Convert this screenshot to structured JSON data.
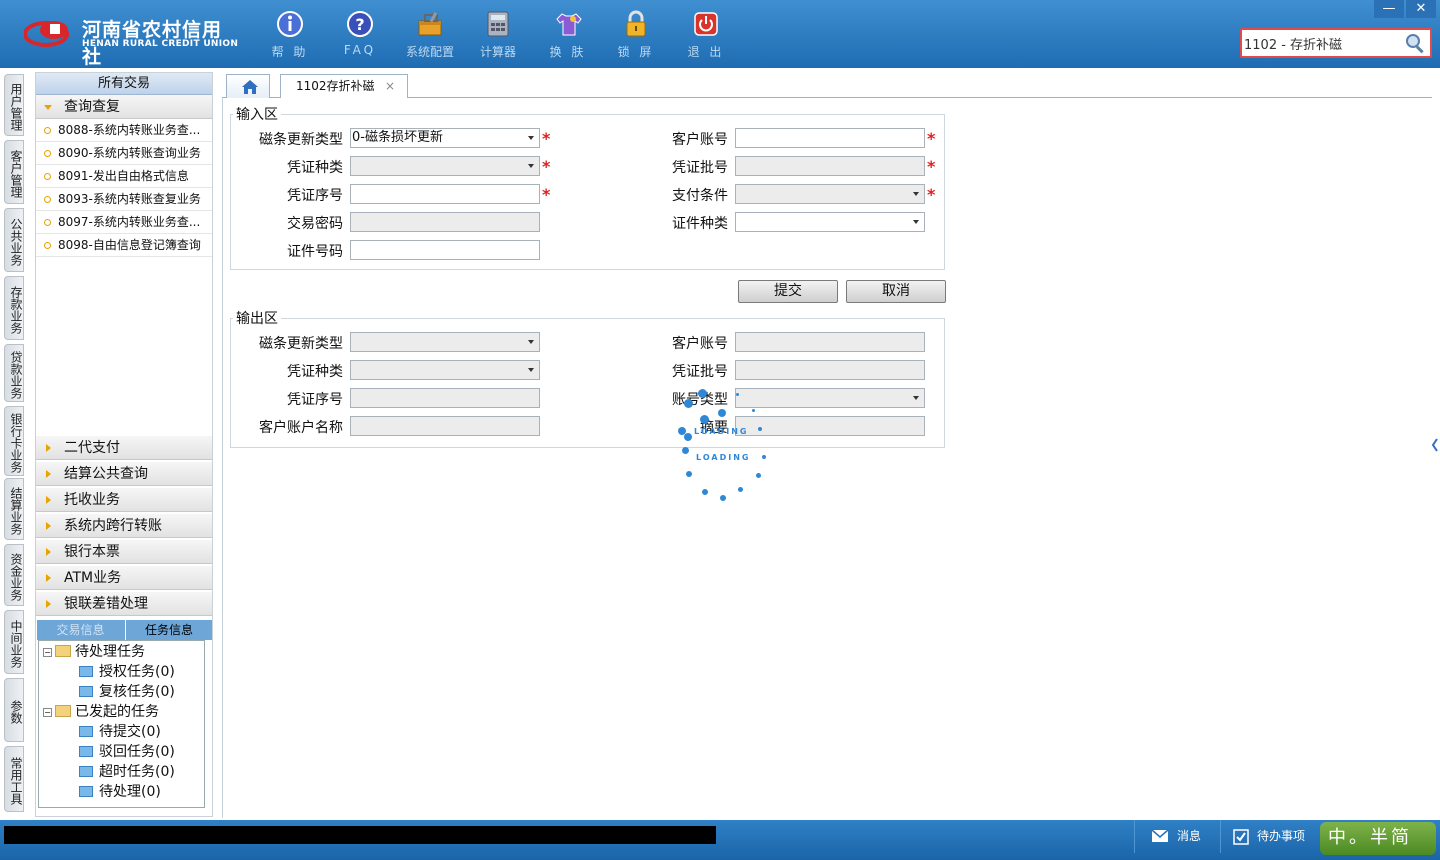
{
  "header": {
    "logo_cn": "河南省农村信用社",
    "logo_en": "HENAN RURAL CREDIT UNION",
    "toolbar": [
      {
        "label": "帮 助",
        "icon": "info-icon"
      },
      {
        "label": "FAQ",
        "icon": "question-icon"
      },
      {
        "label": "系统配置",
        "icon": "toolbox-icon"
      },
      {
        "label": "计算器",
        "icon": "calculator-icon"
      },
      {
        "label": "换 肤",
        "icon": "shirt-icon"
      },
      {
        "label": "锁 屏",
        "icon": "lock-icon"
      },
      {
        "label": "退 出",
        "icon": "power-icon"
      }
    ],
    "search_value": "1102 - 存折补磁",
    "window_min": "—",
    "window_close": "✕"
  },
  "side_tabs": [
    "用户管理",
    "客户管理",
    "公共业务",
    "存款业务",
    "贷款业务",
    "银行卡业务",
    "结算业务",
    "资金业务",
    "中间业务",
    "参数",
    "常用工具"
  ],
  "left_panel": {
    "title": "所有交易",
    "open_group": "查询查复",
    "open_items": [
      "8088-系统内转账业务查...",
      "8090-系统内转账查询业务",
      "8091-发出自由格式信息",
      "8093-系统内转账查复业务",
      "8097-系统内转账业务查...",
      "8098-自由信息登记簿查询"
    ],
    "groups": [
      "二代支付",
      "结算公共查询",
      "托收业务",
      "系统内跨行转账",
      "银行本票",
      "ATM业务",
      "银联差错处理"
    ]
  },
  "task_panel": {
    "tab_trade": "交易信息",
    "tab_task": "任务信息",
    "pending": "待处理任务",
    "pending_children": [
      "授权任务(0)",
      "复核任务(0)"
    ],
    "initiated": "已发起的任务",
    "initiated_children": [
      "待提交(0)",
      "驳回任务(0)",
      "超时任务(0)",
      "待处理(0)"
    ]
  },
  "tabs": {
    "active_tab": "1102存折补磁",
    "close": "×"
  },
  "input_area": {
    "legend": "输入区",
    "mag_update_type_label": "磁条更新类型",
    "mag_update_type_value": "0-磁条损坏更新",
    "voucher_type_label": "凭证种类",
    "voucher_seq_label": "凭证序号",
    "tx_password_label": "交易密码",
    "id_number_label": "证件号码",
    "customer_account_label": "客户账号",
    "voucher_batch_label": "凭证批号",
    "pay_condition_label": "支付条件",
    "id_type_label": "证件种类",
    "required_mark": "*"
  },
  "buttons": {
    "submit": "提交",
    "cancel": "取消"
  },
  "output_area": {
    "legend": "输出区",
    "mag_update_type_label": "磁条更新类型",
    "voucher_type_label": "凭证种类",
    "voucher_seq_label": "凭证序号",
    "customer_account_name_label": "客户账户名称",
    "customer_account_label": "客户账号",
    "voucher_batch_label": "凭证批号",
    "account_type_label": "账号类型",
    "summary_label": "摘要"
  },
  "loading": {
    "text": "LOADING"
  },
  "status_bar": {
    "message": "消息",
    "todo": "待办事项",
    "ime": "中。半简"
  },
  "colors": {
    "header_blue": "#1f6cb2",
    "required_red": "#e02020",
    "accent_orange": "#e8a400",
    "status_blue": "#1b64a8"
  }
}
